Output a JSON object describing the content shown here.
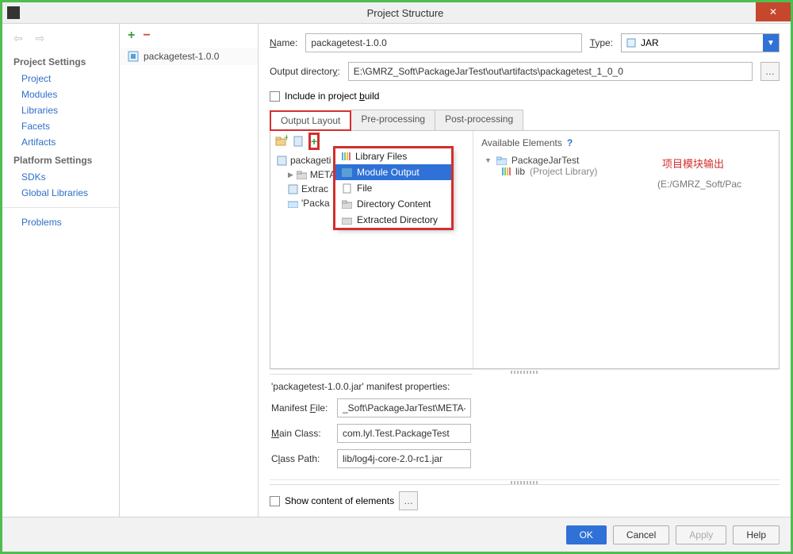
{
  "title": "Project Structure",
  "sidebar": {
    "project_settings_label": "Project Settings",
    "items": {
      "project": "Project",
      "modules": "Modules",
      "libraries": "Libraries",
      "facets": "Facets",
      "artifacts": "Artifacts"
    },
    "platform_settings_label": "Platform Settings",
    "platform": {
      "sdks": "SDKs",
      "global": "Global Libraries"
    },
    "problems": "Problems"
  },
  "mid": {
    "selected": "packagetest-1.0.0"
  },
  "form": {
    "name_label": "Name:",
    "name_value": "packagetest-1.0.0",
    "type_label": "Type:",
    "type_value": "JAR",
    "outdir_label": "Output directory:",
    "outdir_value": "E:\\GMRZ_Soft\\PackageJarTest\\out\\artifacts\\packagetest_1_0_0",
    "include_label": "Include in project build"
  },
  "tabs": {
    "output": "Output Layout",
    "pre": "Pre-processing",
    "post": "Post-processing"
  },
  "layout_tree": {
    "root": "packageti",
    "meta": "META",
    "extrac": "Extrac",
    "packa": "'Packa"
  },
  "context_menu": {
    "library_files": "Library Files",
    "module_output": "Module Output",
    "file": "File",
    "directory_content": "Directory Content",
    "extracted_directory": "Extracted Directory"
  },
  "annotation": "项目模块输出",
  "hidden_path_text": "(E:/GMRZ_Soft/Pac",
  "available": {
    "header": "Available Elements",
    "project": "PackageJarTest",
    "lib": "lib",
    "lib_note": "(Project Library)"
  },
  "manifest": {
    "head": "'packagetest-1.0.0.jar' manifest properties:",
    "file_label": "Manifest File:",
    "file_value": "_Soft\\PackageJarTest\\META-INF\\MANIFEST",
    "main_label": "Main Class:",
    "main_value": "com.lyl.Test.PackageTest",
    "cp_label": "Class Path:",
    "cp_value": "lib/log4j-core-2.0-rc1.jar"
  },
  "show_content": "Show content of elements",
  "buttons": {
    "ok": "OK",
    "cancel": "Cancel",
    "apply": "Apply",
    "help": "Help"
  }
}
